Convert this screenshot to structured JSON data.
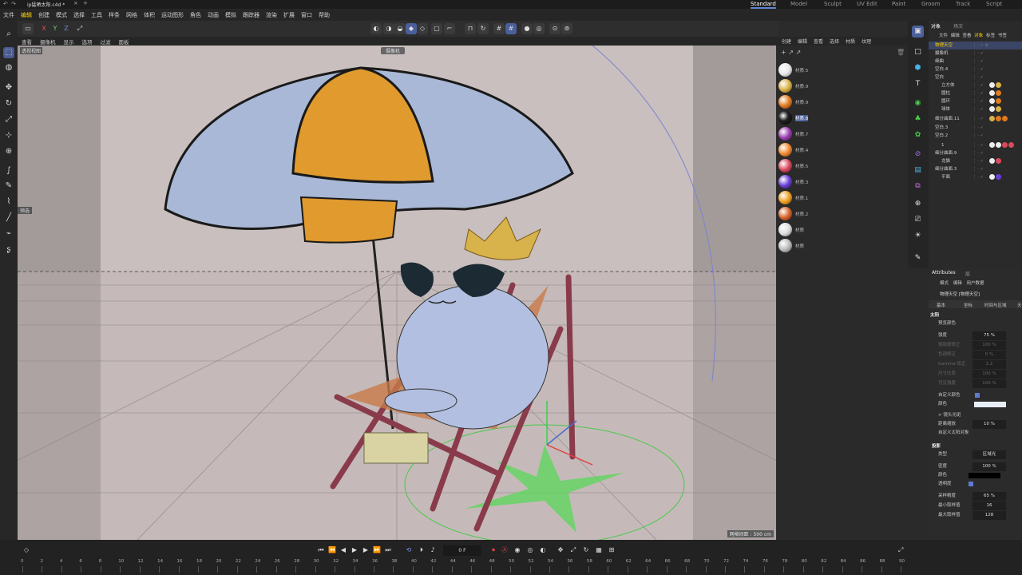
{
  "app": {
    "file_name": "ip猛晒太阳.c4d *",
    "layout_tabs": [
      "Standard",
      "Model",
      "Sculpt",
      "UV Edit",
      "Paint",
      "Groom",
      "Track",
      "Script"
    ],
    "active_layout": "Standard"
  },
  "menu": [
    "文件",
    "编辑",
    "创建",
    "模式",
    "选择",
    "工具",
    "样条",
    "网格",
    "体积",
    "运动图形",
    "角色",
    "动画",
    "模拟",
    "跟踪器",
    "渲染",
    "扩展",
    "窗口",
    "帮助"
  ],
  "toolbar": {
    "axes": [
      "X",
      "Y",
      "Z"
    ]
  },
  "viewport": {
    "menu": [
      "查看",
      "摄像机",
      "显示",
      "选项",
      "过滤",
      "面板"
    ],
    "label": "透视视图",
    "camera_label": "摄像机",
    "side_label": "预选",
    "grid_info": "网格间距 : 500 cm",
    "bg_color": "#c9bfbe",
    "floor_color": "#bcb2b2"
  },
  "materials": [
    {
      "name": "材质.5",
      "color": "#e8e8e8"
    },
    {
      "name": "材质.9",
      "color": "#d9b24a"
    },
    {
      "name": "材质.9",
      "color": "#e07a1e"
    },
    {
      "name": "材质.8",
      "color": "#222222"
    },
    {
      "name": "材质.7",
      "color": "#9c3fb0"
    },
    {
      "name": "材质.4",
      "color": "#f08a30"
    },
    {
      "name": "材质.5",
      "color": "#d94a5e"
    },
    {
      "name": "材质.3",
      "color": "#6a3fd6"
    },
    {
      "name": "材质.1",
      "color": "#f0a020"
    },
    {
      "name": "材质.2",
      "color": "#d7642a"
    },
    {
      "name": "材质",
      "color": "#dddddd"
    },
    {
      "name": "材质",
      "color": "#bbbbbb"
    }
  ],
  "material_menu": [
    "创建",
    "编辑",
    "查看",
    "选择",
    "材质",
    "纹理"
  ],
  "object_manager": {
    "tabs": [
      "对象",
      "场次"
    ],
    "menu": [
      "文件",
      "编辑",
      "查看",
      "对象",
      "标签",
      "书签"
    ],
    "objects": [
      {
        "name": "物理天空",
        "indent": 0,
        "selected": true
      },
      {
        "name": "摄像机",
        "indent": 0
      },
      {
        "name": "细曲",
        "indent": 0
      },
      {
        "name": "空白.4",
        "indent": 0
      },
      {
        "name": "空白",
        "indent": 0
      },
      {
        "name": "立方体",
        "indent": 1
      },
      {
        "name": "圆柱",
        "indent": 1
      },
      {
        "name": "圆环",
        "indent": 1
      },
      {
        "name": "球体",
        "indent": 1
      },
      {
        "name": "细分曲面.11",
        "indent": 0
      },
      {
        "name": "空白.3",
        "indent": 0
      },
      {
        "name": "空白.2",
        "indent": 0
      },
      {
        "name": "1",
        "indent": 0
      },
      {
        "name": "细分曲面.9",
        "indent": 0
      },
      {
        "name": "龙猫",
        "indent": 1
      },
      {
        "name": "细分曲面.3",
        "indent": 0
      },
      {
        "name": "平面",
        "indent": 1
      }
    ]
  },
  "attributes": {
    "title": "Attributes",
    "layer_tab": "层",
    "menu": [
      "模式",
      "编辑",
      "用户数据"
    ],
    "object_title": "物理天空 [物理天空]",
    "tabs": [
      "基本",
      "坐标",
      "时间与区域",
      "天"
    ],
    "section_sun": "太阳",
    "rows": [
      {
        "key": "预览颜色",
        "value": "",
        "dim": false
      },
      {
        "key": "强度",
        "value": "75 %",
        "dim": false
      },
      {
        "key": "饱和度修正",
        "value": "100 %",
        "dim": true
      },
      {
        "key": "色调修正",
        "value": "0 %",
        "dim": true
      },
      {
        "key": "Gamma 修正",
        "value": "2.2",
        "dim": true
      },
      {
        "key": "尺寸比率",
        "value": "100 %",
        "dim": true
      },
      {
        "key": "可见强度",
        "value": "100 %",
        "dim": true
      }
    ],
    "custom_color_label": "自定义颜色",
    "color_label": "颜色",
    "lens_flare_label": "> 镜头光斑",
    "distance_scale_label": "距离缩放",
    "distance_scale_value": "10 %",
    "custom_sun_label": "自定义太阳对象",
    "section_shadow": "投影",
    "shadow_rows": [
      {
        "key": "类型",
        "value": "区域光"
      },
      {
        "key": "密度",
        "value": "100 %"
      },
      {
        "key": "颜色",
        "value": ""
      },
      {
        "key": "透明度",
        "value": ""
      },
      {
        "key": "采样精度",
        "value": "65 %"
      },
      {
        "key": "最小取样值",
        "value": "16"
      },
      {
        "key": "最大取样值",
        "value": "128"
      }
    ]
  },
  "timeline": {
    "frame": "0 F",
    "ticks": [
      "0",
      "2",
      "4",
      "6",
      "8",
      "10",
      "12",
      "14",
      "16",
      "18",
      "20",
      "22",
      "24",
      "26",
      "28",
      "30",
      "32",
      "34",
      "36",
      "38",
      "40",
      "42",
      "44",
      "46",
      "48",
      "50",
      "52",
      "54",
      "56",
      "58",
      "60",
      "62",
      "64",
      "66",
      "68",
      "70",
      "72",
      "74",
      "76",
      "78",
      "80",
      "82",
      "84",
      "86",
      "88",
      "90"
    ]
  }
}
